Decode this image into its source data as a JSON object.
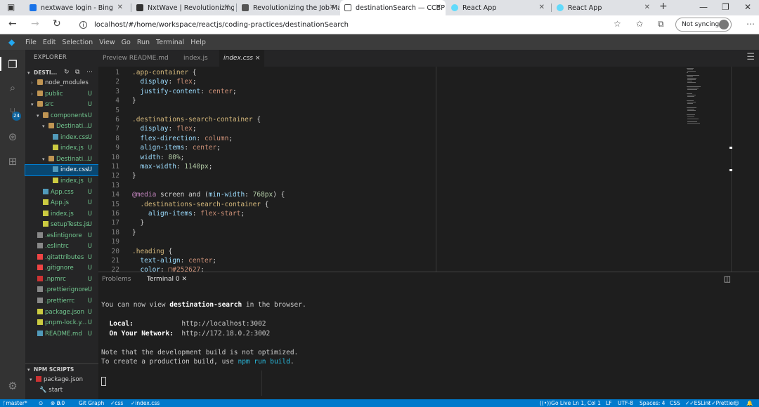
{
  "browser": {
    "tabs": [
      {
        "title": "nextwave login - Bing",
        "active": false
      },
      {
        "title": "NxtWave | Revolutionizing the Job Ma",
        "active": false
      },
      {
        "title": "Revolutionizing the Job Ma",
        "active": false
      },
      {
        "title": "destinationSearch — CCBP",
        "active": true
      },
      {
        "title": "React App",
        "active": false
      },
      {
        "title": "React App",
        "active": false
      }
    ],
    "url": "localhost/#/home/workspace/reactjs/coding-practices/destinationSearch",
    "sync_label": "Not syncing"
  },
  "menu": [
    "File",
    "Edit",
    "Selection",
    "View",
    "Go",
    "Run",
    "Terminal",
    "Help"
  ],
  "activity_badge": "24",
  "explorer": {
    "title": "EXPLORER",
    "root": "DESTI...",
    "items": [
      {
        "label": "node_modules",
        "type": "folder",
        "open": false,
        "badge": ""
      },
      {
        "label": "public",
        "type": "folder",
        "open": false,
        "badge": "U"
      },
      {
        "label": "src",
        "type": "folder",
        "open": true,
        "badge": "U"
      },
      {
        "label": "components",
        "type": "folder",
        "open": true,
        "badge": "U"
      },
      {
        "label": "Destinati...",
        "type": "folder",
        "open": true,
        "badge": "U"
      },
      {
        "label": "index.css",
        "type": "css",
        "badge": "U"
      },
      {
        "label": "index.js",
        "type": "js",
        "badge": "U"
      },
      {
        "label": "Destinati...",
        "type": "folder",
        "open": true,
        "badge": "U"
      },
      {
        "label": "index.css",
        "type": "css",
        "badge": "U",
        "selected": true
      },
      {
        "label": "index.js",
        "type": "js",
        "badge": "U"
      },
      {
        "label": "App.css",
        "type": "css",
        "badge": "U"
      },
      {
        "label": "App.js",
        "type": "js",
        "badge": "U"
      },
      {
        "label": "index.js",
        "type": "js",
        "badge": "U"
      },
      {
        "label": "setupTests.js",
        "type": "js",
        "badge": "U"
      },
      {
        "label": ".eslintignore",
        "type": "cfg",
        "badge": "U"
      },
      {
        "label": ".eslintrc",
        "type": "cfg",
        "badge": "U"
      },
      {
        "label": ".gitattributes",
        "type": "git",
        "badge": "U"
      },
      {
        "label": ".gitignore",
        "type": "git",
        "badge": "U"
      },
      {
        "label": ".npmrc",
        "type": "npm",
        "badge": "U"
      },
      {
        "label": ".prettierignore",
        "type": "cfg",
        "badge": "U"
      },
      {
        "label": ".prettierrc",
        "type": "cfg",
        "badge": "U"
      },
      {
        "label": "package.json",
        "type": "json",
        "badge": "U"
      },
      {
        "label": "pnpm-lock.y...",
        "type": "json",
        "badge": "U"
      },
      {
        "label": "README.md",
        "type": "md",
        "badge": "U"
      }
    ],
    "npm_title": "NPM SCRIPTS",
    "npm_items": [
      "package.json",
      "start"
    ]
  },
  "editor_tabs": [
    {
      "label": "Preview README.md",
      "active": false
    },
    {
      "label": "index.js",
      "active": false
    },
    {
      "label": "index.css",
      "active": true,
      "close": "×"
    }
  ],
  "code_lines": [
    [
      {
        "t": ".app-container",
        "c": "sel_"
      },
      {
        "t": " {",
        "c": "punc"
      }
    ],
    [
      {
        "t": "  display",
        "c": "prop"
      },
      {
        "t": ": ",
        "c": "punc"
      },
      {
        "t": "flex",
        "c": "val"
      },
      {
        "t": ";",
        "c": "punc"
      }
    ],
    [
      {
        "t": "  justify-content",
        "c": "prop"
      },
      {
        "t": ": ",
        "c": "punc"
      },
      {
        "t": "center",
        "c": "val"
      },
      {
        "t": ";",
        "c": "punc"
      }
    ],
    [
      {
        "t": "}",
        "c": "punc"
      }
    ],
    [],
    [
      {
        "t": ".destinations-search-container",
        "c": "sel_"
      },
      {
        "t": " {",
        "c": "punc"
      }
    ],
    [
      {
        "t": "  display",
        "c": "prop"
      },
      {
        "t": ": ",
        "c": "punc"
      },
      {
        "t": "flex",
        "c": "val"
      },
      {
        "t": ";",
        "c": "punc"
      }
    ],
    [
      {
        "t": "  flex-direction",
        "c": "prop"
      },
      {
        "t": ": ",
        "c": "punc"
      },
      {
        "t": "column",
        "c": "val"
      },
      {
        "t": ";",
        "c": "punc"
      }
    ],
    [
      {
        "t": "  align-items",
        "c": "prop"
      },
      {
        "t": ": ",
        "c": "punc"
      },
      {
        "t": "center",
        "c": "val"
      },
      {
        "t": ";",
        "c": "punc"
      }
    ],
    [
      {
        "t": "  width",
        "c": "prop"
      },
      {
        "t": ": ",
        "c": "punc"
      },
      {
        "t": "80%",
        "c": "num"
      },
      {
        "t": ";",
        "c": "punc"
      }
    ],
    [
      {
        "t": "  max-width",
        "c": "prop"
      },
      {
        "t": ": ",
        "c": "punc"
      },
      {
        "t": "1140px",
        "c": "num"
      },
      {
        "t": ";",
        "c": "punc"
      }
    ],
    [
      {
        "t": "}",
        "c": "punc"
      }
    ],
    [],
    [
      {
        "t": "@media",
        "c": "kw"
      },
      {
        "t": " screen and (",
        "c": "punc"
      },
      {
        "t": "min-width",
        "c": "prop"
      },
      {
        "t": ": ",
        "c": "punc"
      },
      {
        "t": "768px",
        "c": "num"
      },
      {
        "t": ") {",
        "c": "punc"
      }
    ],
    [
      {
        "t": "  .destinations-search-container",
        "c": "sel_"
      },
      {
        "t": " {",
        "c": "punc"
      }
    ],
    [
      {
        "t": "    align-items",
        "c": "prop"
      },
      {
        "t": ": ",
        "c": "punc"
      },
      {
        "t": "flex-start",
        "c": "val"
      },
      {
        "t": ";",
        "c": "punc"
      }
    ],
    [
      {
        "t": "  }",
        "c": "punc"
      }
    ],
    [
      {
        "t": "}",
        "c": "punc"
      }
    ],
    [],
    [
      {
        "t": ".heading",
        "c": "sel_"
      },
      {
        "t": " {",
        "c": "punc"
      }
    ],
    [
      {
        "t": "  text-align",
        "c": "prop"
      },
      {
        "t": ": ",
        "c": "punc"
      },
      {
        "t": "center",
        "c": "val"
      },
      {
        "t": ";",
        "c": "punc"
      }
    ],
    [
      {
        "t": "  color",
        "c": "prop"
      },
      {
        "t": ": ",
        "c": "punc"
      },
      {
        "t": "□#252627",
        "c": "val"
      },
      {
        "t": ";",
        "c": "punc"
      }
    ]
  ],
  "panel": {
    "tabs": [
      "Problems",
      "Terminal 0"
    ],
    "terminal": {
      "l1a": "You can now view ",
      "l1b": "destination-search",
      "l1c": " in the browser.",
      "local_label": "  Local:",
      "local_url": "http://localhost:3002",
      "net_label": "  On Your Network:",
      "net_url": "http://172.18.0.2:3002",
      "l4": "Note that the development build is not optimized.",
      "l5a": "To create a production build, use ",
      "l5b": "npm run build",
      "l5c": "."
    }
  },
  "status": {
    "branch": "master*",
    "errors": "0",
    "warnings": "0",
    "graph": "Git Graph",
    "css": "css",
    "file": "index.css",
    "golive": "Go Live",
    "pos": "Ln 1, Col 1",
    "eol": "LF",
    "enc": "UTF-8",
    "spaces": "Spaces: 4",
    "lang": "CSS",
    "eslint": "ESLint",
    "prettier": "Prettier"
  },
  "colors": {
    "accent": "#007acc",
    "selection": "#094771"
  }
}
